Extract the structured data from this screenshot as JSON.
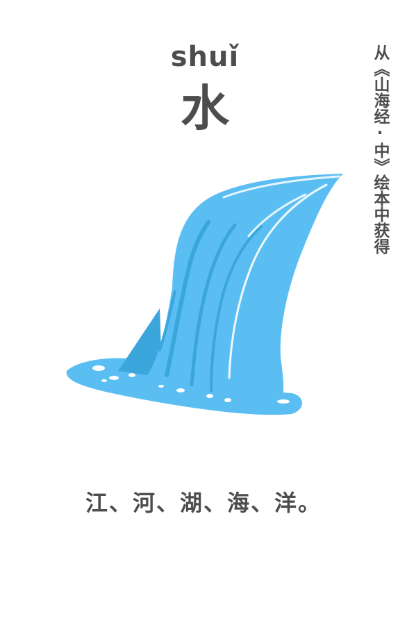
{
  "card": {
    "pinyin": "shuǐ",
    "character": "水",
    "source_note": "从《山海经·中》绘本中获得",
    "caption": "江、河、湖、海、洋。",
    "illustration_icon": "waterfall-icon"
  },
  "colors": {
    "text": "#4d4d4d",
    "water_main": "#5bbef2",
    "water_shadow": "#3aa6dc",
    "water_highlight": "#ffffff",
    "background": "#ffffff"
  }
}
